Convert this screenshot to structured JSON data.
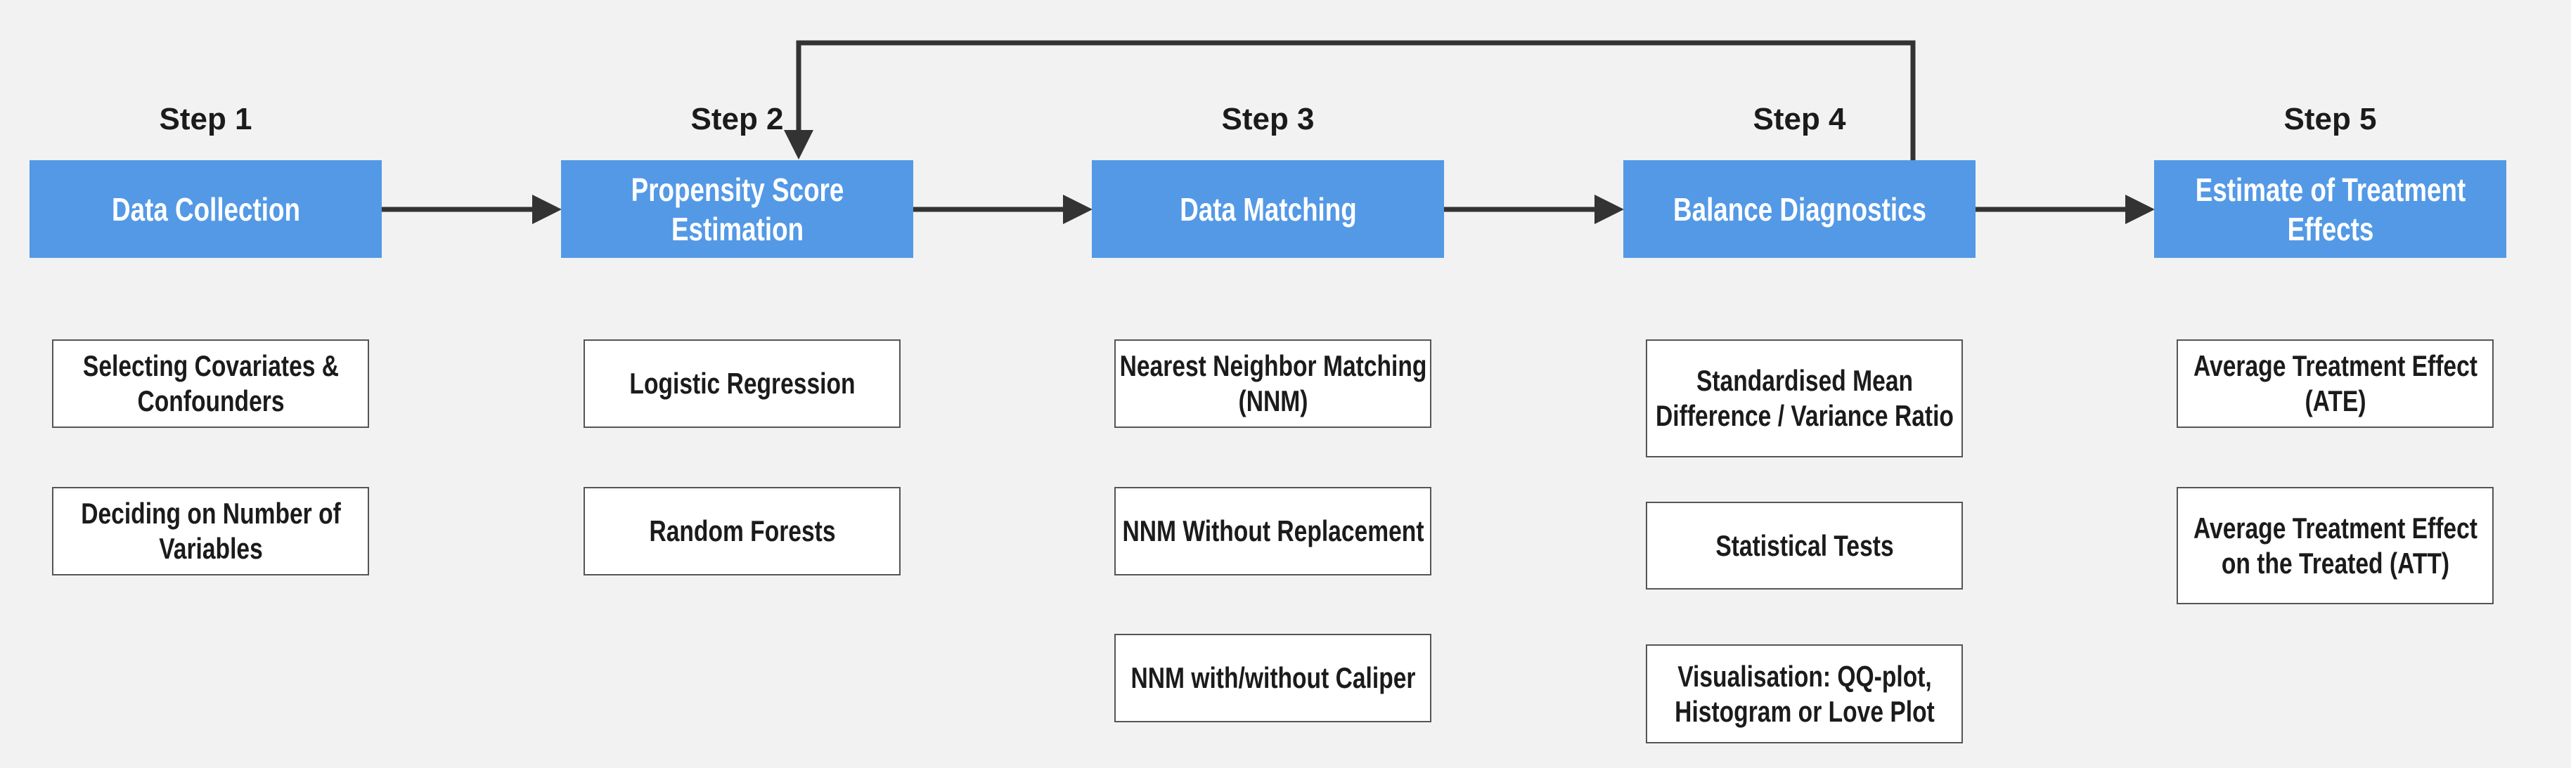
{
  "colors": {
    "background": "#f2f2f2",
    "step_box": "#5399e6",
    "arrow": "#333333"
  },
  "steps": [
    {
      "label": "Step 1",
      "title": "Data Collection",
      "items": [
        "Selecting Covariates & Confounders",
        "Deciding on Number of Variables"
      ]
    },
    {
      "label": "Step 2",
      "title": "Propensity Score Estimation",
      "items": [
        "Logistic Regression",
        "Random Forests"
      ]
    },
    {
      "label": "Step 3",
      "title": "Data Matching",
      "items": [
        "Nearest Neighbor Matching (NNM)",
        "NNM Without Replacement",
        "NNM with/without Caliper"
      ]
    },
    {
      "label": "Step 4",
      "title": "Balance Diagnostics",
      "items": [
        "Standardised Mean Difference / Variance Ratio",
        "Statistical Tests",
        "Visualisation: QQ-plot, Histogram or Love Plot"
      ]
    },
    {
      "label": "Step 5",
      "title": "Estimate of Treatment Effects",
      "items": [
        "Average Treatment Effect (ATE)",
        "Average Treatment Effect on the Treated (ATT)"
      ]
    }
  ],
  "connections": [
    {
      "from": "Step 1",
      "to": "Step 2"
    },
    {
      "from": "Step 2",
      "to": "Step 3"
    },
    {
      "from": "Step 3",
      "to": "Step 4"
    },
    {
      "from": "Step 4",
      "to": "Step 5"
    },
    {
      "from": "Step 4",
      "to": "Step 2",
      "type": "feedback"
    }
  ]
}
